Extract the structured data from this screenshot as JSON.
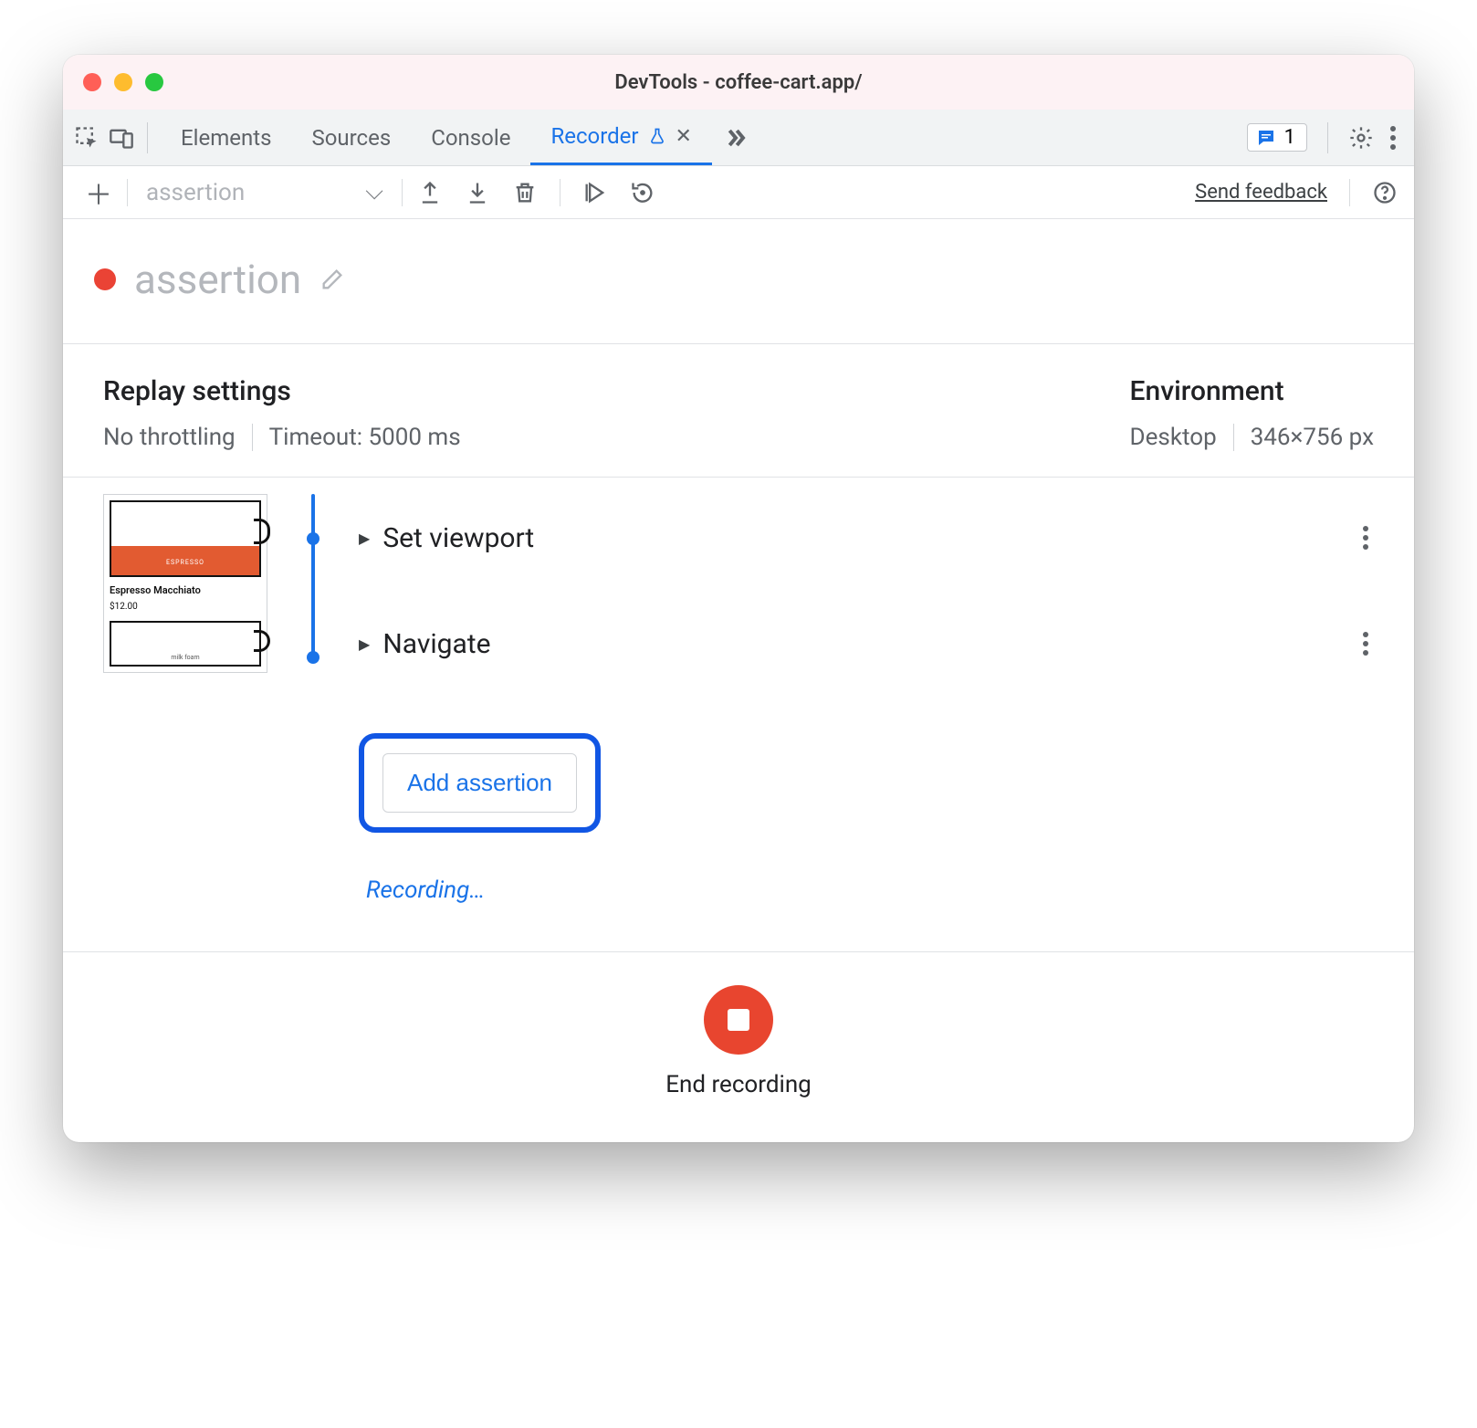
{
  "window": {
    "title": "DevTools - coffee-cart.app/"
  },
  "tabs": {
    "items": [
      "Elements",
      "Sources",
      "Console",
      "Recorder"
    ],
    "active": "Recorder"
  },
  "issues": {
    "count": "1"
  },
  "subbar": {
    "recording_select": "assertion",
    "feedback": "Send feedback"
  },
  "title": {
    "name": "assertion"
  },
  "replay": {
    "heading": "Replay settings",
    "throttling": "No throttling",
    "timeout": "Timeout: 5000 ms"
  },
  "environment": {
    "heading": "Environment",
    "device": "Desktop",
    "dimensions": "346×756 px"
  },
  "thumbnail": {
    "label": "Espresso Macchiato",
    "price": "$12.00",
    "bar_text": "ESPRESSO",
    "secondary": "milk foam"
  },
  "steps": [
    {
      "label": "Set viewport"
    },
    {
      "label": "Navigate"
    }
  ],
  "actions": {
    "add_assertion": "Add assertion",
    "recording_status": "Recording…",
    "end_recording": "End recording"
  }
}
